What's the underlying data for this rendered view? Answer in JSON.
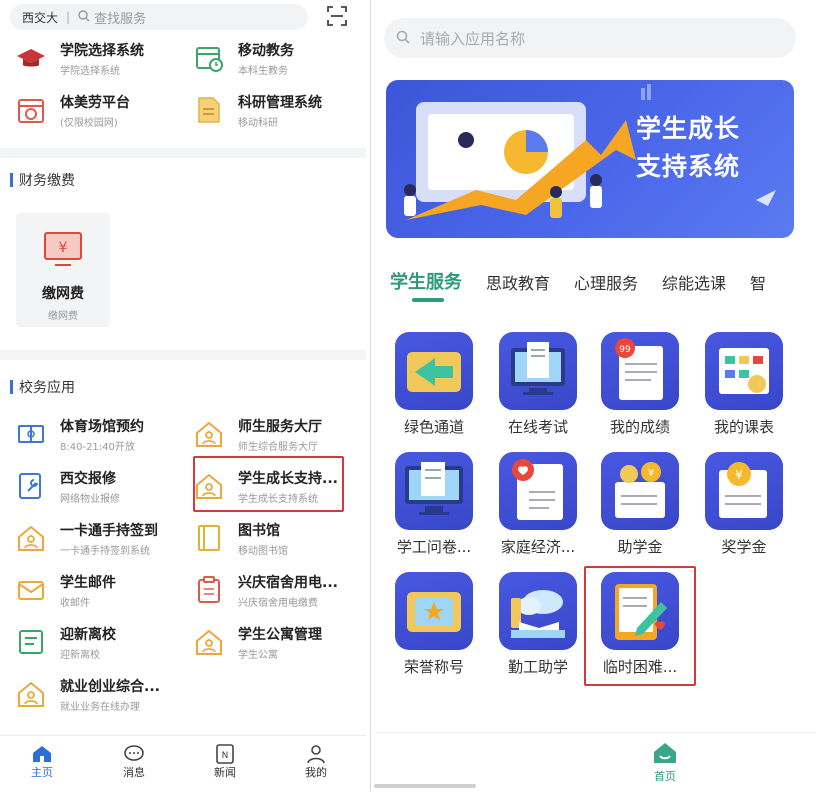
{
  "left": {
    "search": {
      "campus": "西交大",
      "placeholder": "查找服务"
    },
    "top_apps": [
      {
        "title": "学院选择系统",
        "sub": "学院选择系统",
        "icon": "graduation-cap-icon"
      },
      {
        "title": "移动教务",
        "sub": "本科生教务",
        "icon": "calendar-clock-icon"
      },
      {
        "title": "体美劳平台",
        "sub": "(仅限校园网)",
        "icon": "calendar-icon"
      },
      {
        "title": "科研管理系统",
        "sub": "移动科研",
        "icon": "document-icon"
      }
    ],
    "finance": {
      "title": "财务缴费",
      "card": {
        "title": "缴网费",
        "sub": "缴网费",
        "icon": "yen-monitor-icon"
      }
    },
    "school": {
      "title": "校务应用",
      "apps": [
        {
          "title": "体育场馆预约",
          "sub": "8:40-21:40开放",
          "icon": "stadium-icon"
        },
        {
          "title": "师生服务大厅",
          "sub": "师生综合服务大厅",
          "icon": "home-person-icon"
        },
        {
          "title": "西交报修",
          "sub": "网络物业报修",
          "icon": "wrench-doc-icon"
        },
        {
          "title": "学生成长支持...",
          "sub": "学生成长支持系统",
          "icon": "home-person-icon"
        },
        {
          "title": "一卡通手持签到",
          "sub": "一卡通手持签到系统",
          "icon": "home-person-icon"
        },
        {
          "title": "图书馆",
          "sub": "移动图书馆",
          "icon": "book-icon"
        },
        {
          "title": "学生邮件",
          "sub": "收邮件",
          "icon": "mail-icon"
        },
        {
          "title": "兴庆宿舍用电...",
          "sub": "兴庆宿舍用电缴费",
          "icon": "clipboard-icon"
        },
        {
          "title": "迎新离校",
          "sub": "迎新离校",
          "icon": "form-icon"
        },
        {
          "title": "学生公寓管理",
          "sub": "学生公寓",
          "icon": "home-person-icon"
        },
        {
          "title": "就业创业综合...",
          "sub": "就业业务在线办理",
          "icon": "home-person-icon"
        }
      ]
    },
    "nav": [
      {
        "label": "主页",
        "icon": "home-icon"
      },
      {
        "label": "消息",
        "icon": "chat-icon"
      },
      {
        "label": "新闻",
        "icon": "news-icon"
      },
      {
        "label": "我的",
        "icon": "user-icon"
      }
    ]
  },
  "right": {
    "search": {
      "placeholder": "请输入应用名称"
    },
    "banner": {
      "line1": "学生成长",
      "line2": "支持系统"
    },
    "tabs": [
      "学生服务",
      "思政教育",
      "心理服务",
      "综能选课",
      "智"
    ],
    "tiles": [
      {
        "label": "绿色通道",
        "icon": "green-channel-icon"
      },
      {
        "label": "在线考试",
        "icon": "online-exam-icon"
      },
      {
        "label": "我的成绩",
        "icon": "grades-icon"
      },
      {
        "label": "我的课表",
        "icon": "schedule-icon"
      },
      {
        "label": "学工问卷...",
        "icon": "survey-icon"
      },
      {
        "label": "家庭经济...",
        "icon": "family-economy-icon"
      },
      {
        "label": "助学金",
        "icon": "grant-icon"
      },
      {
        "label": "奖学金",
        "icon": "scholarship-icon"
      },
      {
        "label": "荣誉称号",
        "icon": "honor-icon"
      },
      {
        "label": "勤工助学",
        "icon": "work-study-icon"
      },
      {
        "label": "临时困难...",
        "icon": "temporary-hardship-icon"
      }
    ],
    "nav": {
      "label": "首页",
      "icon": "home-icon"
    }
  },
  "colors": {
    "accent_blue": "#2d6fd6",
    "accent_green": "#2d9a7a",
    "highlight_red": "#d33a3a",
    "tile_blue": "#4152d8"
  }
}
